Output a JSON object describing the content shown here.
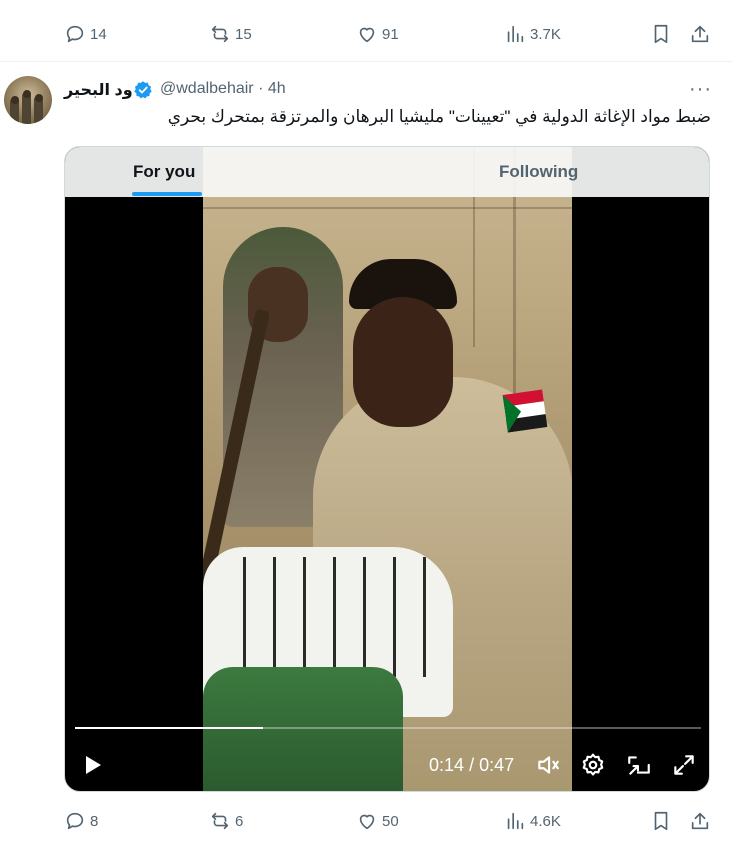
{
  "prev_tweet": {
    "replies": "14",
    "reposts": "15",
    "likes": "91",
    "views": "3.7K"
  },
  "tweet": {
    "display_name": "ود البحير",
    "handle": "@wdalbehair",
    "separator": "·",
    "time": "4h",
    "more": "···",
    "text": "ضبط مواد الإغاثة الدولية في \"تعيينات\" مليشيا البرهان والمرتزقة بمتحرك بحري",
    "verified_color": "#1d9bf0"
  },
  "nav_tabs": {
    "for_you": "For you",
    "following": "Following",
    "active_color": "#1d9bf0"
  },
  "video": {
    "current_time": "0:14",
    "time_separator": "/",
    "duration": "0:47",
    "progress_fraction": 0.3
  },
  "tweet_actions": {
    "replies": "8",
    "reposts": "6",
    "likes": "50",
    "views": "4.6K"
  },
  "icons": {
    "reply": "reply-icon",
    "repost": "repost-icon",
    "like": "heart-icon",
    "views": "views-icon",
    "bookmark": "bookmark-icon",
    "share": "share-icon",
    "play": "play-icon",
    "volume": "volume-icon",
    "settings": "settings-icon",
    "pip": "picture-in-picture-icon",
    "fullscreen": "fullscreen-icon"
  }
}
